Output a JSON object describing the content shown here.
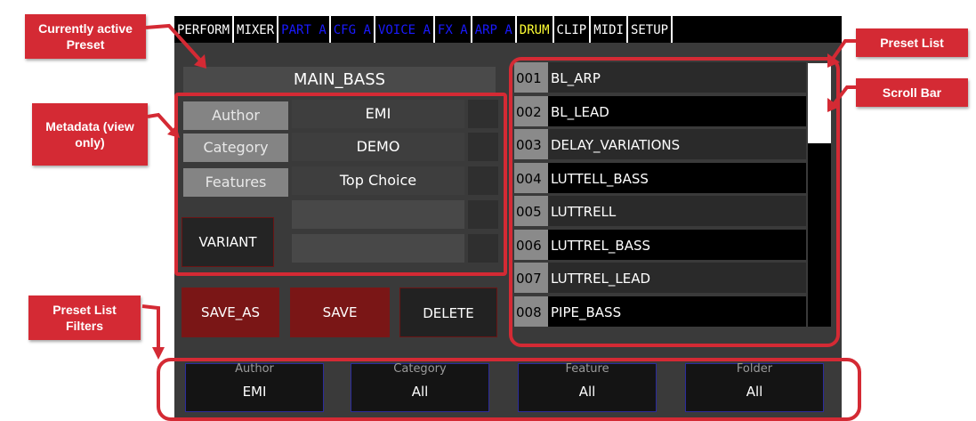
{
  "tabs": [
    {
      "label": "PERFORM",
      "color": "#ffffff"
    },
    {
      "label": "MIXER",
      "color": "#ffffff"
    },
    {
      "label": "PART A",
      "color": "#1a1aff"
    },
    {
      "label": "CFG A",
      "color": "#1a1aff"
    },
    {
      "label": "VOICE A",
      "color": "#1a1aff"
    },
    {
      "label": "FX A",
      "color": "#1a1aff"
    },
    {
      "label": "ARP A",
      "color": "#1a1aff"
    },
    {
      "label": "DRUM",
      "color": "#ffff33"
    },
    {
      "label": "CLIP",
      "color": "#ffffff"
    },
    {
      "label": "MIDI",
      "color": "#ffffff"
    },
    {
      "label": "SETUP",
      "color": "#ffffff"
    }
  ],
  "preset": {
    "name": "MAIN_BASS",
    "metadata": [
      {
        "label": "Author",
        "value": "EMI"
      },
      {
        "label": "Category",
        "value": "DEMO"
      },
      {
        "label": "Features",
        "value": "Top Choice"
      }
    ],
    "variant_label": "VARIANT"
  },
  "actions": {
    "save_as": "SAVE_AS",
    "save": "SAVE",
    "delete": "DELETE"
  },
  "preset_list": [
    {
      "num": "001",
      "name": "BL_ARP"
    },
    {
      "num": "002",
      "name": "BL_LEAD"
    },
    {
      "num": "003",
      "name": "DELAY_VARIATIONS"
    },
    {
      "num": "004",
      "name": "LUTTELL_BASS"
    },
    {
      "num": "005",
      "name": "LUTTRELL"
    },
    {
      "num": "006",
      "name": "LUTTREL_BASS"
    },
    {
      "num": "007",
      "name": "LUTTREL_LEAD"
    },
    {
      "num": "008",
      "name": "PIPE_BASS"
    }
  ],
  "filters": [
    {
      "label": "Author",
      "value": "EMI"
    },
    {
      "label": "Category",
      "value": "All"
    },
    {
      "label": "Feature",
      "value": "All"
    },
    {
      "label": "Folder",
      "value": "All"
    }
  ],
  "callouts": {
    "active_preset": "Currently active Preset",
    "metadata": "Metadata (view only)",
    "list_filters": "Preset List Filters",
    "preset_list": "Preset List",
    "scroll_bar": "Scroll Bar"
  },
  "colors": {
    "callout": "#d42a34",
    "screen_bg": "#3a3a3a",
    "filter_border": "#2b2b9e"
  }
}
